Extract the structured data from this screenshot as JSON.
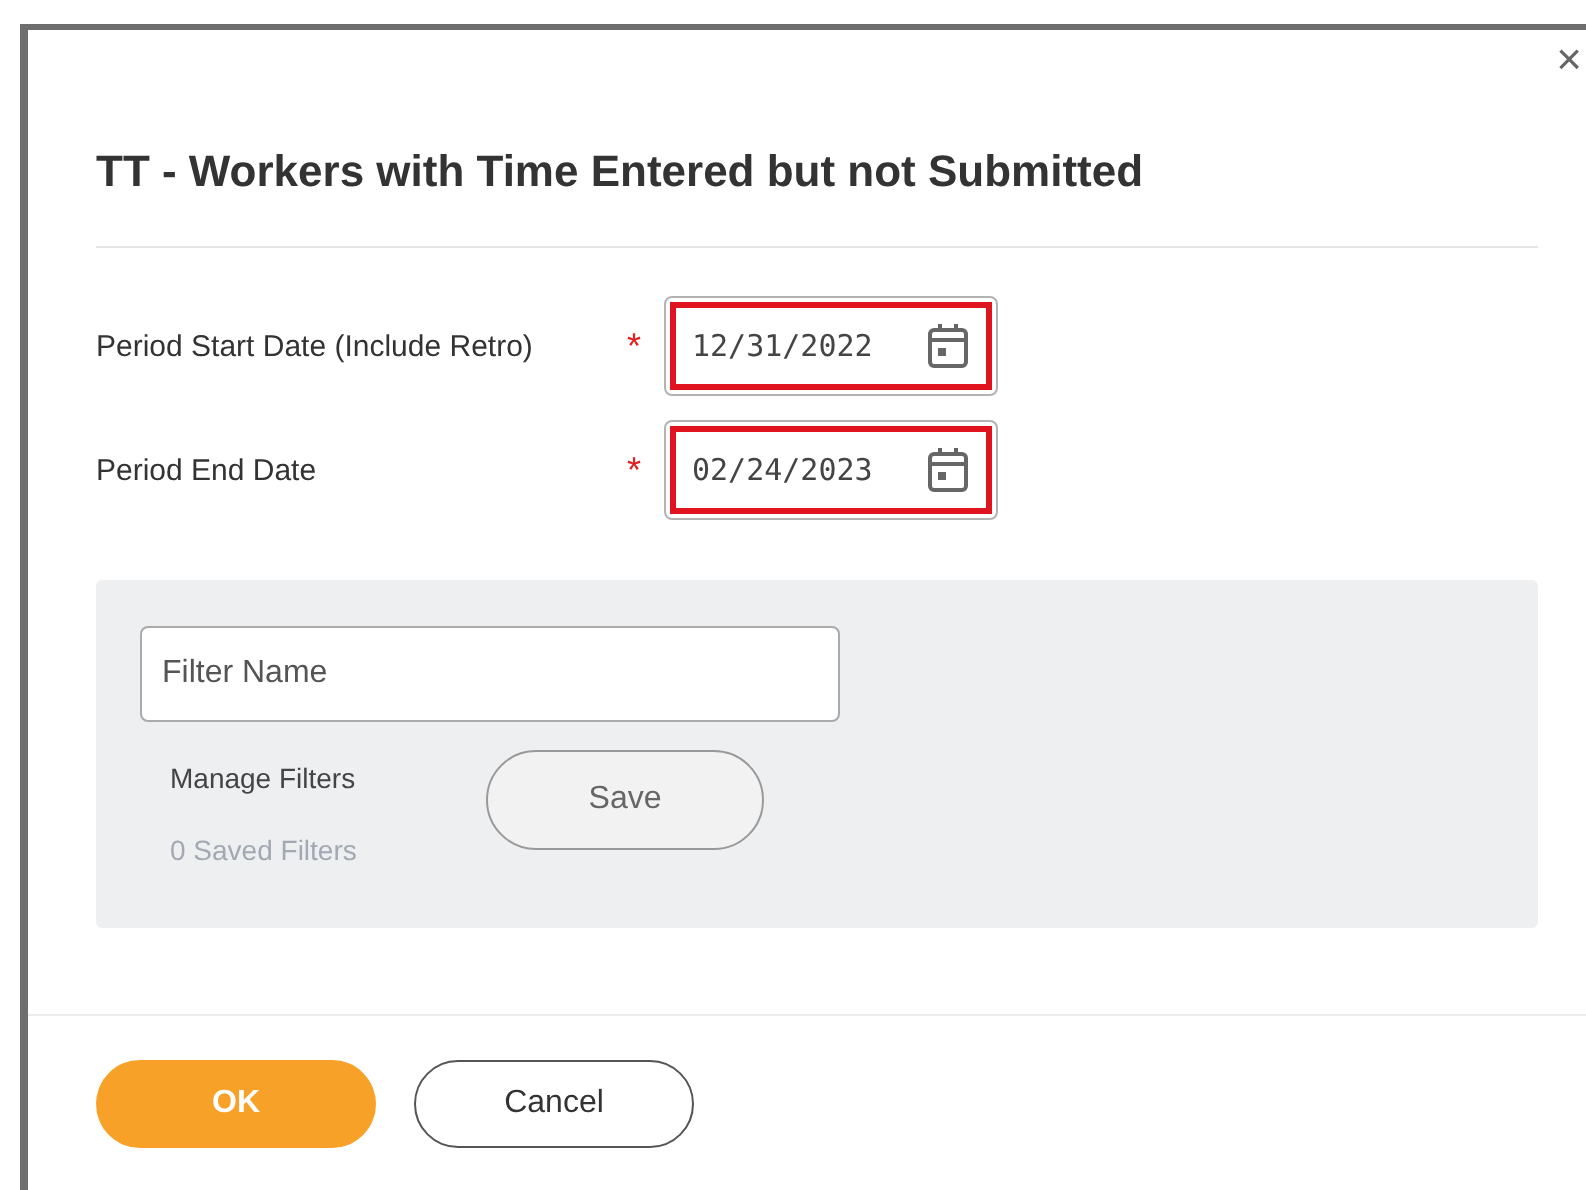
{
  "dialog": {
    "close": "×",
    "title": "TT - Workers with Time Entered but not Submitted"
  },
  "fields": [
    {
      "label": "Period Start Date (Include Retro)",
      "marker": "*",
      "value": "12/31/2022",
      "highlighted": true
    },
    {
      "label": "Period End Date",
      "marker": "*",
      "value": "02/24/2023",
      "highlighted": true
    }
  ],
  "filter": {
    "placeholder": "Filter Name",
    "manage": "Manage Filters",
    "count": "0 Saved Filters",
    "save": "Save"
  },
  "buttons": [
    {
      "label": "OK",
      "kind": "primary"
    },
    {
      "label": "Cancel",
      "kind": "secondary"
    }
  ]
}
